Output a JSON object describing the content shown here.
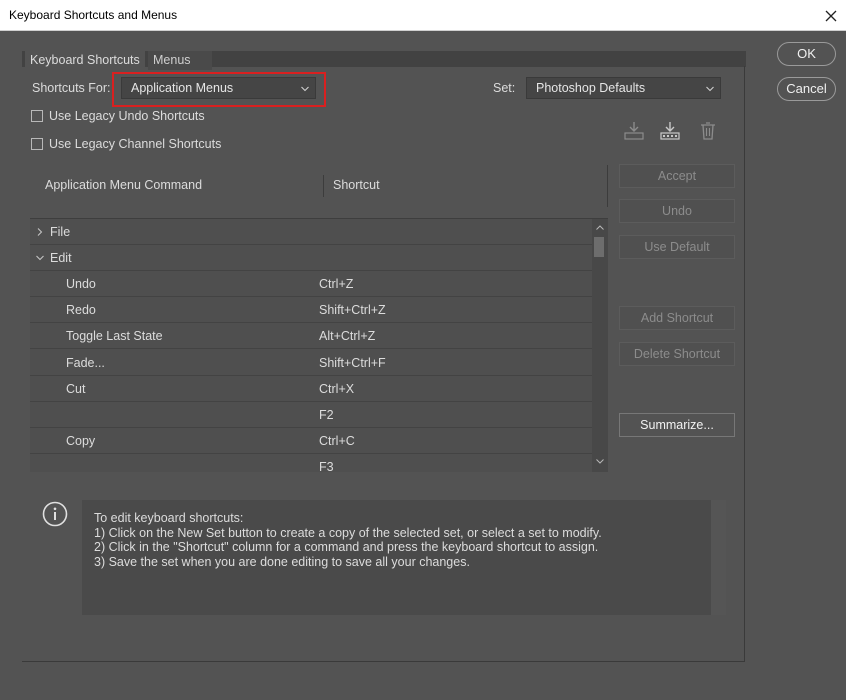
{
  "window": {
    "title": "Keyboard Shortcuts and Menus"
  },
  "tabs": [
    {
      "label": "Keyboard Shortcuts",
      "active": true
    },
    {
      "label": "Menus",
      "active": false
    }
  ],
  "shortcuts_for": {
    "label": "Shortcuts For:",
    "value": "Application Menus"
  },
  "set": {
    "label": "Set:",
    "value": "Photoshop Defaults"
  },
  "options": {
    "legacy_undo": {
      "label": "Use Legacy Undo Shortcuts",
      "checked": false
    },
    "legacy_channel": {
      "label": "Use Legacy Channel Shortcuts",
      "checked": false
    }
  },
  "toolbar_icons": [
    "save-set-icon",
    "new-set-icon",
    "delete-set-icon"
  ],
  "columns": {
    "command": "Application Menu Command",
    "shortcut": "Shortcut"
  },
  "rows": [
    {
      "type": "group",
      "expanded": false,
      "command": "File",
      "shortcut": ""
    },
    {
      "type": "group",
      "expanded": true,
      "command": "Edit",
      "shortcut": ""
    },
    {
      "type": "item",
      "command": "Undo",
      "shortcut": "Ctrl+Z"
    },
    {
      "type": "item",
      "command": "Redo",
      "shortcut": "Shift+Ctrl+Z"
    },
    {
      "type": "item",
      "command": "Toggle Last State",
      "shortcut": "Alt+Ctrl+Z"
    },
    {
      "type": "item",
      "command": "Fade...",
      "shortcut": "Shift+Ctrl+F"
    },
    {
      "type": "item",
      "command": "Cut",
      "shortcut": "Ctrl+X"
    },
    {
      "type": "item",
      "command": "",
      "shortcut": "F2"
    },
    {
      "type": "item",
      "command": "Copy",
      "shortcut": "Ctrl+C"
    },
    {
      "type": "item",
      "command": "",
      "shortcut": "F3"
    }
  ],
  "side_buttons": {
    "ok": "OK",
    "cancel": "Cancel",
    "accept": "Accept",
    "undo": "Undo",
    "use_default": "Use Default",
    "add_shortcut": "Add Shortcut",
    "delete_shortcut": "Delete Shortcut",
    "summarize": "Summarize..."
  },
  "info": {
    "lines": [
      "To edit keyboard shortcuts:",
      "1) Click on the New Set button to create a copy of the selected set, or select a set to modify.",
      "2) Click in the \"Shortcut\" column for a command and press the keyboard shortcut to assign.",
      "3) Save the set when you are done editing to save all your changes."
    ]
  },
  "colors": {
    "dialog_bg": "#535353",
    "highlight": "#d92020",
    "titlebar_bg": "#ffffff"
  }
}
